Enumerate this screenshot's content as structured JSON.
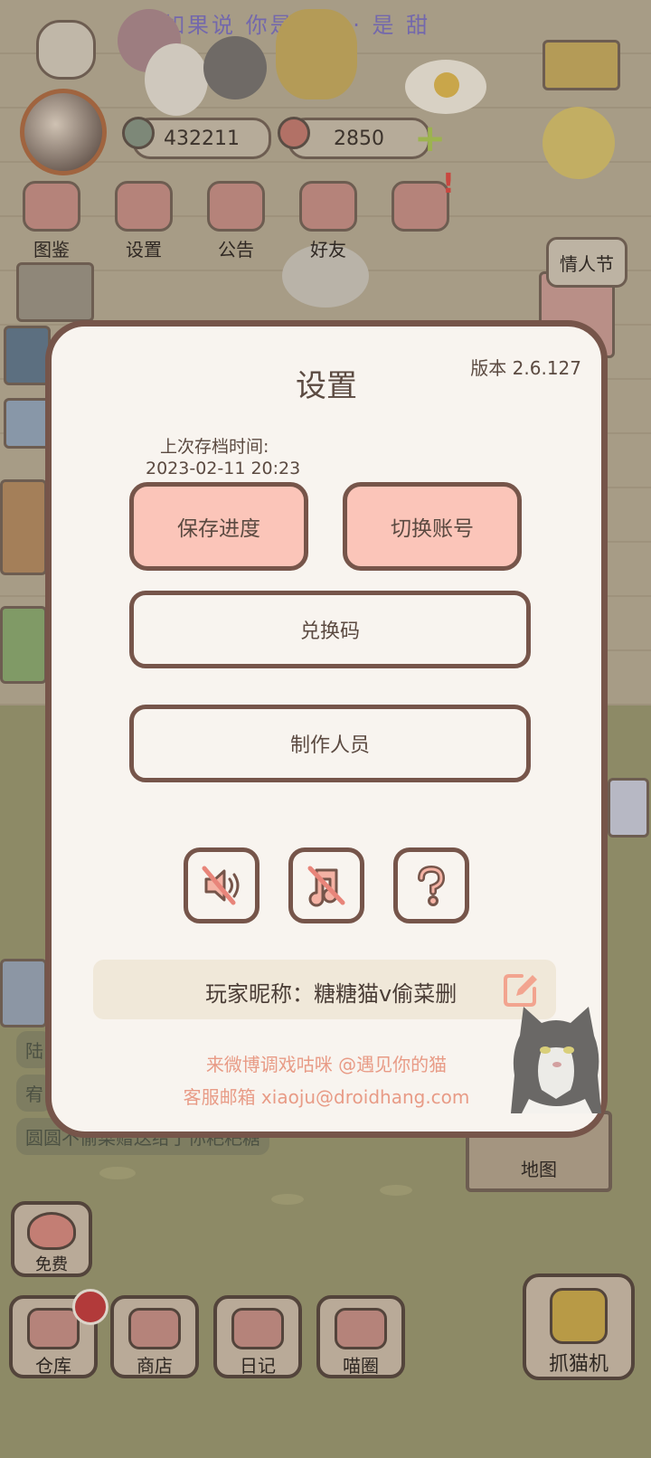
{
  "watermark": "如果说 你是我的 · 是 甜",
  "hud": {
    "fish_count": "432211",
    "heart_count": "2850",
    "plus_label": "+"
  },
  "top_menu": [
    "图鉴",
    "设置",
    "公告",
    "好友"
  ],
  "notification_mark": "!",
  "side": {
    "valentine_label": "情人节"
  },
  "chat_lines": [
    "陆",
    "宥",
    "圆圆不偷菜赠送给了你粑粑糖"
  ],
  "map_label": "地图",
  "bottom": {
    "free_label": "免费",
    "items": [
      "仓库",
      "商店",
      "日记",
      "喵圈"
    ],
    "claw_label": "抓猫机"
  },
  "dialog": {
    "title": "设置",
    "version": "版本 2.6.127",
    "last_save_label": "上次存档时间:",
    "last_save_time": "2023-02-11 20:23",
    "save_button": "保存进度",
    "switch_button": "切换账号",
    "redeem_button": "兑换码",
    "credits_button": "制作人员",
    "icons": [
      "sound-muted-icon",
      "music-muted-icon",
      "help-icon"
    ],
    "nickname_line": "玩家昵称：糖糖猫v偷菜删",
    "weibo_line": "来微博调戏咕咪 @遇见你的猫",
    "email_line": "客服邮箱 xiaoju@droidhang.com"
  }
}
